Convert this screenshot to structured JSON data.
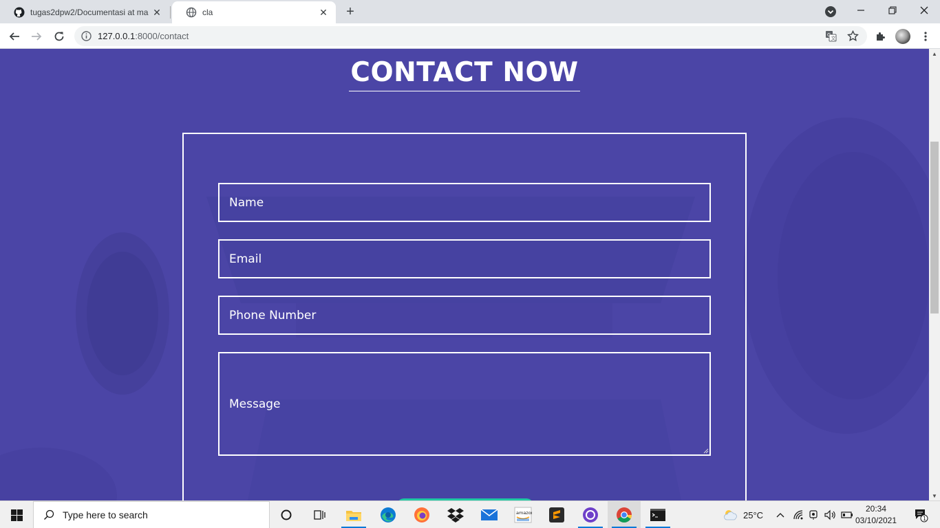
{
  "browser": {
    "tabs": [
      {
        "title": "tugas2dpw2/Documentasi at ma",
        "icon": "github-icon",
        "active": false
      },
      {
        "title": "cla",
        "icon": "globe-icon",
        "active": true
      }
    ],
    "url_host": "127.0.0.1",
    "url_path": ":8000/contact"
  },
  "page": {
    "heading": "CONTACT NOW",
    "form": {
      "name_placeholder": "Name",
      "email_placeholder": "Email",
      "phone_placeholder": "Phone Number",
      "message_placeholder": "Message"
    },
    "colors": {
      "background": "#4b45a6",
      "submit": "#1fc8a3",
      "border": "#ffffff"
    }
  },
  "taskbar": {
    "search_placeholder": "Type here to search",
    "apps": [
      "cortana-icon",
      "task-view-icon",
      "file-explorer-icon",
      "edge-icon",
      "firefox-icon",
      "dropbox-icon",
      "mail-icon",
      "amazon-icon",
      "sublime-text-icon",
      "github-desktop-icon",
      "chrome-icon",
      "terminal-icon"
    ],
    "weather": "25°C",
    "time": "20:34",
    "date": "03/10/2021",
    "notification_count": "1"
  }
}
